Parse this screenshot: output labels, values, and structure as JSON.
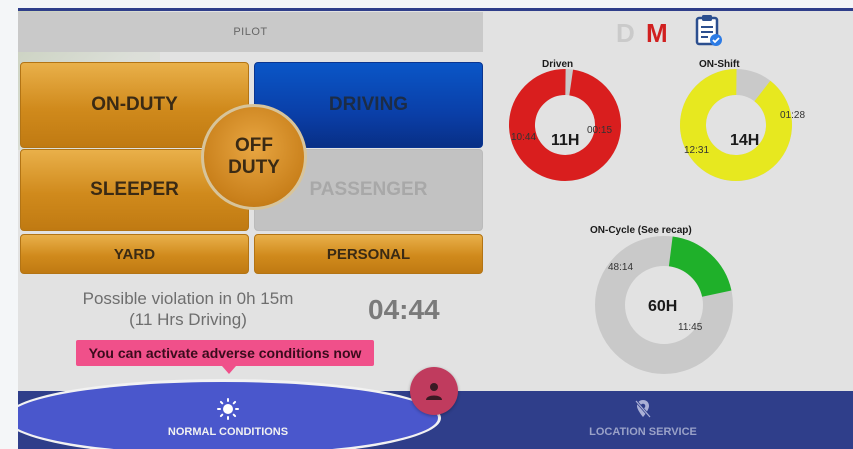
{
  "header": {
    "pilot_label": "PILOT"
  },
  "status_buttons": {
    "on_duty": "ON-DUTY",
    "driving": "DRIVING",
    "sleeper": "SLEEPER",
    "passenger": "PASSENGER",
    "off_duty_line1": "OFF",
    "off_duty_line2": "DUTY",
    "yard": "YARD",
    "personal": "PERSONAL"
  },
  "violation": {
    "line1": "Possible violation in 0h 15m",
    "line2": "(11 Hrs Driving)",
    "countdown": "04:44"
  },
  "tooltip": {
    "text": "You can activate adverse conditions now"
  },
  "indicators": {
    "d": "D",
    "m": "M"
  },
  "charts": {
    "driven": {
      "title": "Driven",
      "center": "11H",
      "used": "10:44",
      "remaining": "00:15",
      "used_fraction": 0.977
    },
    "shift": {
      "title": "ON-Shift",
      "center": "14H",
      "used": "12:31",
      "remaining": "01:28",
      "used_fraction": 0.895
    },
    "cycle": {
      "title": "ON-Cycle (See recap)",
      "center": "60H",
      "used": "48:14",
      "remaining": "11:45",
      "used_fraction": 0.804
    }
  },
  "bottom_nav": {
    "normal_conditions": "NORMAL CONDITIONS",
    "location_service": "LOCATION SERVICE"
  },
  "colors": {
    "driven": "#d91e1e",
    "shift": "#e7e81f",
    "cycle": "#1fb02a",
    "remaining": "#c9c9c9",
    "nav_bar": "#2f3e8a",
    "tooltip": "#f0508a"
  }
}
